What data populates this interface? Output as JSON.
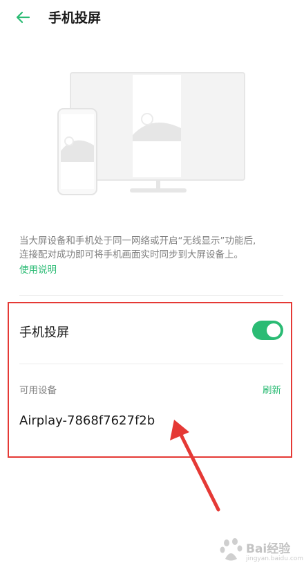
{
  "header": {
    "back_icon": "arrow-left-icon",
    "title": "手机投屏"
  },
  "accent_color": "#2bbb74",
  "description": {
    "line1": "当大屏设备和手机处于同一网络或开启“无线显示”功能后,",
    "line2": "连接配对成功即可将手机画面实时同步到大屏设备上。",
    "help_link": "使用说明"
  },
  "cast_setting": {
    "label": "手机投屏",
    "toggle_on": true
  },
  "devices": {
    "section_label": "可用设备",
    "refresh_label": "刷新",
    "items": [
      "Airplay-7868f7627f2b"
    ]
  },
  "annotation": {
    "frame_color": "#e53935",
    "arrow_color": "#e53935"
  },
  "watermark": {
    "text": "Bai经验",
    "sub": "jingyan.baidu.com"
  }
}
